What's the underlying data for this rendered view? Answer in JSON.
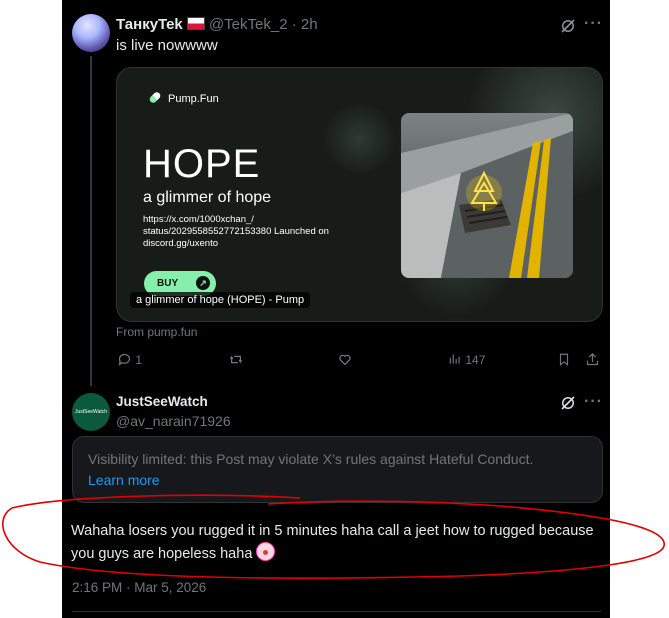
{
  "tweet1": {
    "author_name": "ТанкуTek",
    "handle": "@TekTek_2",
    "separator": "·",
    "time": "2h",
    "text": "is live nowwww",
    "card": {
      "brand": "Pump.Fun",
      "title": "HOPE",
      "subtitle": "a glimmer of hope",
      "description": "https://x.com/1000xchan_/ status/2029558552772153380 Launched on discord.gg/uxento",
      "buy_label": "BUY",
      "buy_arrow": "↗",
      "caption": "a glimmer of hope (HOPE) - Pump"
    },
    "from": "From pump.fun",
    "actions": {
      "replies": "1",
      "views": "147"
    }
  },
  "tweet2": {
    "author_name": "JustSeeWatch",
    "avatar_text": "JustSeeWatch",
    "handle": "@av_narain71926",
    "visibility_notice": "Visibility limited: this Post may violate X’s rules against Hateful Conduct.",
    "learn_more": "Learn more",
    "text": "Wahaha losers you rugged it in 5 minutes haha call a jeet how to rugged because you guys are hopeless haha",
    "timestamp": "2:16 PM · Mar 5, 2026"
  },
  "colors": {
    "background": "#000000",
    "text": "#e7e9ea",
    "muted": "#71767b",
    "link": "#1d9bf0",
    "pump_green": "#86efac",
    "annotation_red": "#e00000"
  },
  "icons": [
    "grok-icon",
    "more-icon",
    "reply-icon",
    "retweet-icon",
    "like-icon",
    "views-icon",
    "bookmark-icon",
    "share-icon",
    "pill-icon",
    "clown-emoji"
  ]
}
